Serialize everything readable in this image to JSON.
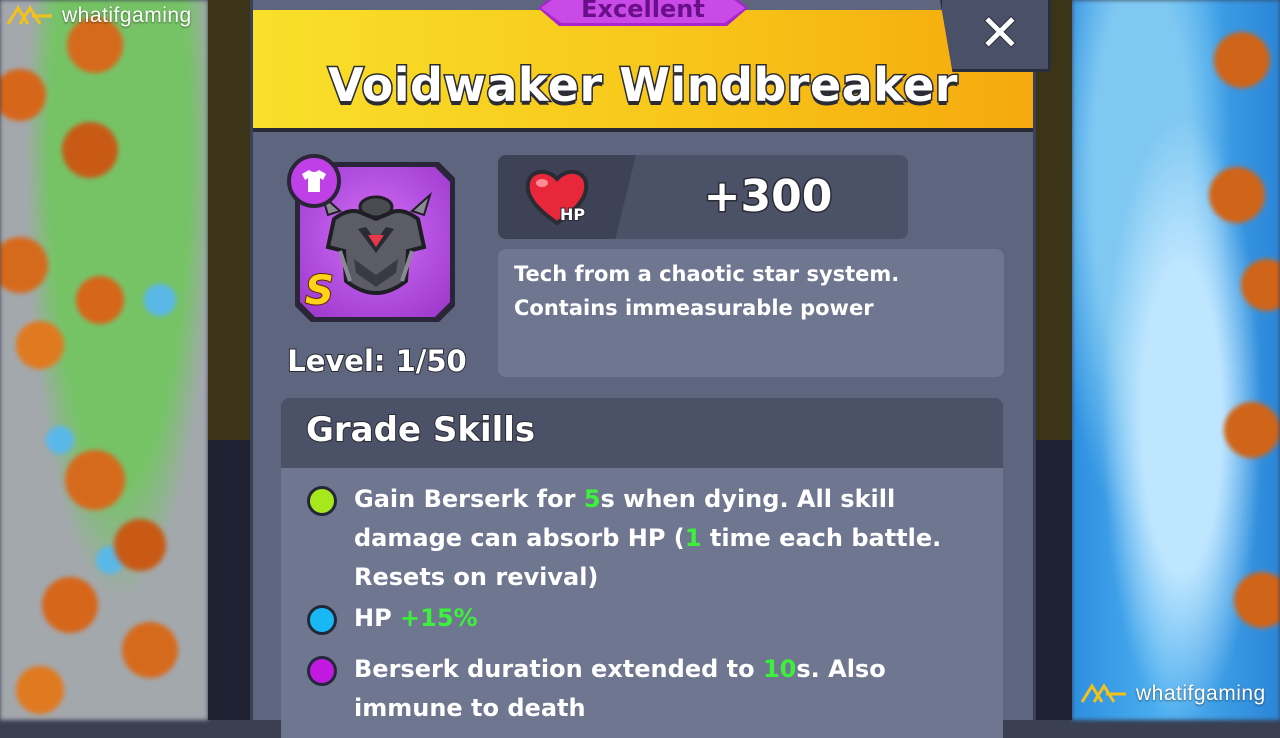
{
  "watermark": {
    "text": "whatifgaming"
  },
  "item": {
    "grade": "Excellent",
    "name": "Voidwaker Windbreaker",
    "rank": "S",
    "level_label": "Level: 1/50",
    "slot_icon": "shirt-icon",
    "stat": {
      "icon": "heart-hp-icon",
      "label": "HP",
      "value": "+300"
    },
    "description": [
      "Tech from a chaotic star system.",
      "Contains immeasurable power"
    ]
  },
  "grade_skills": {
    "title": "Grade Skills",
    "items": [
      {
        "color": "#a6e81c",
        "parts": [
          "Gain Berserk for ",
          "5",
          "s when dying. All skill damage can absorb HP (",
          "1",
          " time each battle. Resets on revival)"
        ]
      },
      {
        "color": "#19b8f5",
        "parts": [
          "HP ",
          "+15%"
        ]
      },
      {
        "color": "#c219e0",
        "parts": [
          "Berserk duration extended to ",
          "10",
          "s. Also immune to death"
        ]
      }
    ]
  },
  "colors": {
    "header_yellow": "#f9d41f",
    "panel": "#5e657f",
    "grade_purple": "#c94ae6",
    "highlight_green": "#3cf03c"
  }
}
